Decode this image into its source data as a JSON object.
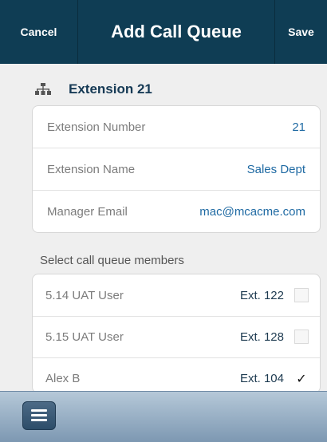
{
  "topbar": {
    "cancel_label": "Cancel",
    "title": "Add Call Queue",
    "save_label": "Save"
  },
  "section": {
    "icon": "org-chart-icon",
    "title": "Extension 21"
  },
  "details": [
    {
      "label": "Extension Number",
      "value": "21"
    },
    {
      "label": "Extension Name",
      "value": "Sales Dept"
    },
    {
      "label": "Manager Email",
      "value": "mac@mcacme.com"
    }
  ],
  "members_caption": "Select call queue members",
  "members": [
    {
      "name": "5.14 UAT User",
      "ext": "Ext. 122",
      "checked": false,
      "check_glyph": ""
    },
    {
      "name": "5.15 UAT User",
      "ext": "Ext. 128",
      "checked": false,
      "check_glyph": ""
    },
    {
      "name": "Alex B",
      "ext": "Ext. 104",
      "checked": true,
      "check_glyph": "✓"
    }
  ],
  "bottombar": {
    "menu_icon": "hamburger-menu-icon"
  },
  "colors": {
    "topbar_bg": "#0f3d54",
    "accent_text": "#1f6aa3",
    "section_title": "#163a55"
  }
}
